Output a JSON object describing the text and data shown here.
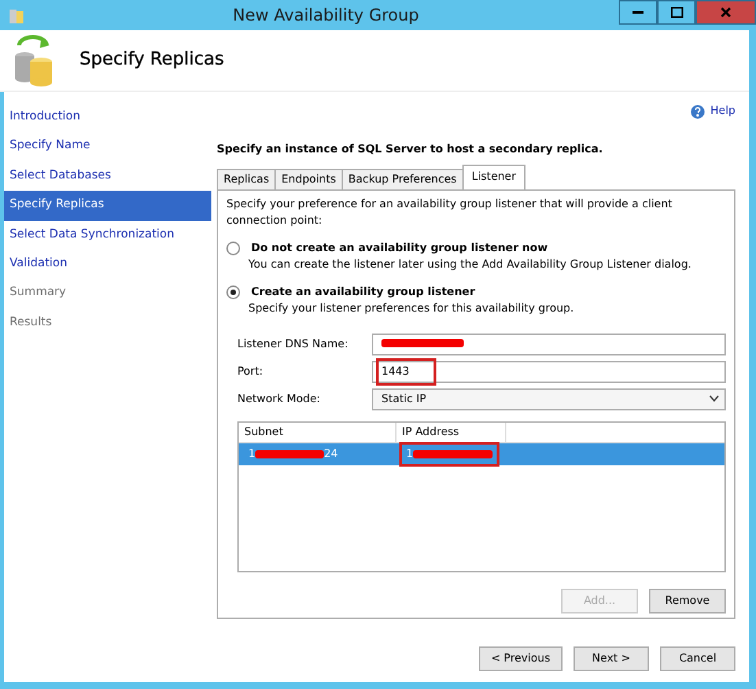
{
  "window": {
    "title": "New Availability Group"
  },
  "header": {
    "title": "Specify Replicas"
  },
  "nav": [
    {
      "label": "Introduction",
      "selected": false,
      "disabled": false
    },
    {
      "label": "Specify Name",
      "selected": false,
      "disabled": false
    },
    {
      "label": "Select Databases",
      "selected": false,
      "disabled": false
    },
    {
      "label": "Specify Replicas",
      "selected": true,
      "disabled": false
    },
    {
      "label": "Select Data Synchronization",
      "selected": false,
      "disabled": false
    },
    {
      "label": "Validation",
      "selected": false,
      "disabled": false
    },
    {
      "label": "Summary",
      "selected": false,
      "disabled": true
    },
    {
      "label": "Results",
      "selected": false,
      "disabled": true
    }
  ],
  "help": "Help",
  "instruction": "Specify an instance of SQL Server to host a secondary replica.",
  "tabs": [
    {
      "label": "Replicas",
      "selected": false
    },
    {
      "label": "Endpoints",
      "selected": false
    },
    {
      "label": "Backup Preferences",
      "selected": false
    },
    {
      "label": "Listener",
      "selected": true
    }
  ],
  "listener": {
    "intro": "Specify your preference for an availability group listener that will provide a client connection point:",
    "options": [
      {
        "label": "Do not create an availability group listener now",
        "hint": "You can create the listener later using the Add Availability Group Listener dialog.",
        "selected": false
      },
      {
        "label": "Create an availability group listener",
        "hint": "Specify your listener preferences for this availability group.",
        "selected": true
      }
    ],
    "fields": [
      {
        "label": "Listener DNS Name:",
        "kind": "text",
        "redacted": true,
        "highlighted": false
      },
      {
        "label": "Port:",
        "kind": "text",
        "value": "1443",
        "redacted": false,
        "highlighted": true
      },
      {
        "label": "Network Mode:",
        "kind": "select",
        "value": "Static IP",
        "redacted": false,
        "highlighted": false
      }
    ],
    "table": {
      "columns": [
        "Subnet",
        "IP Address"
      ],
      "rows": [
        {
          "selected": true,
          "cells": [
            {
              "before": "1",
              "after": "24",
              "redacted": true,
              "highlighted": false
            },
            {
              "before": "1",
              "redacted": true,
              "highlighted": true
            }
          ]
        }
      ]
    },
    "buttons": [
      {
        "label": "Add...",
        "disabled": true
      },
      {
        "label": "Remove",
        "disabled": false
      }
    ]
  },
  "footer": [
    {
      "label": "< Previous"
    },
    {
      "label": "Next >"
    },
    {
      "label": "Cancel"
    }
  ]
}
